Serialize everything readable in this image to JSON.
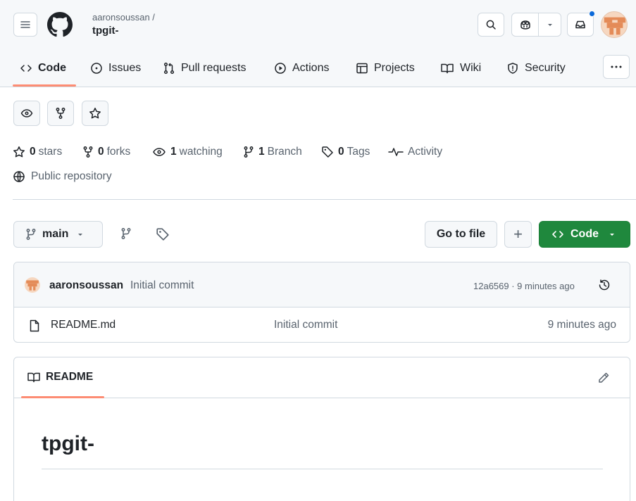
{
  "header": {
    "owner": "aaronsoussan /",
    "repo": "tpgit-"
  },
  "nav": {
    "code": "Code",
    "issues": "Issues",
    "pull_requests": "Pull requests",
    "actions": "Actions",
    "projects": "Projects",
    "wiki": "Wiki",
    "security": "Security"
  },
  "stats": {
    "stars_count": "0",
    "stars_label": "stars",
    "forks_count": "0",
    "forks_label": "forks",
    "watching_count": "1",
    "watching_label": "watching",
    "branch_count": "1",
    "branch_label": "Branch",
    "tags_count": "0",
    "tags_label": "Tags",
    "activity_label": "Activity",
    "visibility": "Public repository"
  },
  "toolbar": {
    "branch": "main",
    "go_to_file": "Go to file",
    "add": "+",
    "code": "Code"
  },
  "commit": {
    "author": "aaronsoussan",
    "message": "Initial commit",
    "hash_time": "12a6569 · 9 minutes ago"
  },
  "files": [
    {
      "name": "README.md",
      "message": "Initial commit",
      "time": "9 minutes ago"
    }
  ],
  "readme": {
    "tab": "README",
    "heading": "tpgit-"
  },
  "colors": {
    "accent_underline": "#fd8c73",
    "primary_button": "#1f883d",
    "notification_dot": "#0969da"
  }
}
